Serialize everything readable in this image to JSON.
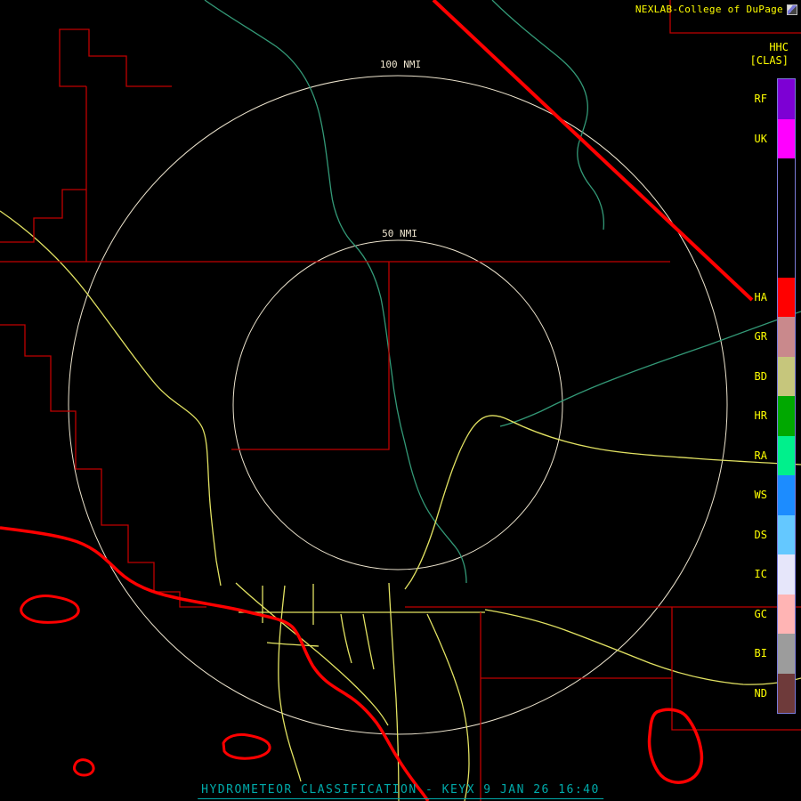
{
  "header": {
    "attribution": "NEXLAB-College of DuPage"
  },
  "legend": {
    "title": "HHC",
    "subtitle": "[CLAS]",
    "items": [
      {
        "label": "RF",
        "color": "#7D00D4"
      },
      {
        "label": "UK",
        "color": "#FF00FF"
      },
      {
        "label": "",
        "color": "#000000"
      },
      {
        "label": "",
        "color": "#000000"
      },
      {
        "label": "",
        "color": "#000000"
      },
      {
        "label": "HA",
        "color": "#FF0000"
      },
      {
        "label": "GR",
        "color": "#C9898C"
      },
      {
        "label": "BD",
        "color": "#C6C67C"
      },
      {
        "label": "HR",
        "color": "#00A800"
      },
      {
        "label": "RA",
        "color": "#00F08C"
      },
      {
        "label": "WS",
        "color": "#1C8CFF"
      },
      {
        "label": "DS",
        "color": "#64C8FF"
      },
      {
        "label": "IC",
        "color": "#E6E6FA"
      },
      {
        "label": "GC",
        "color": "#FFB4B4"
      },
      {
        "label": "BI",
        "color": "#9C9C9C"
      },
      {
        "label": "ND",
        "color": "#6E3A3A"
      }
    ]
  },
  "rings": [
    {
      "label": "100 NMI",
      "radius_nmi": 100
    },
    {
      "label": "50 NMI",
      "radius_nmi": 50
    }
  ],
  "status_bar": {
    "text": "HYDROMETEOR CLASSIFICATION - KEYX 9 JAN 26 16:40"
  },
  "colors": {
    "background": "#000000",
    "county": "#C00000",
    "state_border": "#FF0000",
    "highway": "#E2E262",
    "river": "#339977",
    "ring": "#EDE4CE",
    "label_yellow": "#FFFF00",
    "status": "#00AAAA",
    "legend_border": "#7A7AD8"
  }
}
